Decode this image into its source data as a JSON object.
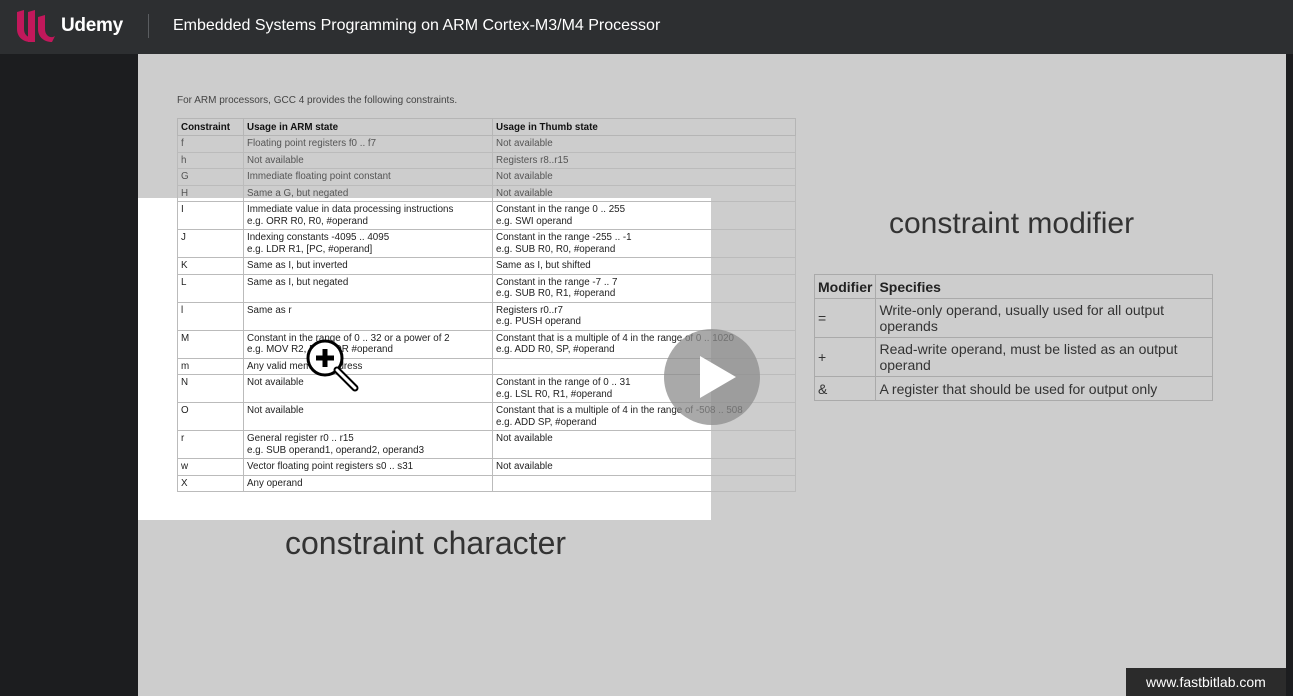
{
  "header": {
    "brand": "Udemy",
    "course_title": "Embedded Systems Programming on ARM Cortex-M3/M4 Processor"
  },
  "slide": {
    "intro": "For ARM processors, GCC 4 provides the following constraints.",
    "constraints_table": {
      "headers": [
        "Constraint",
        "Usage in ARM state",
        "Usage in Thumb state"
      ],
      "rows": [
        {
          "c": "f",
          "arm": "Floating point registers f0 .. f7",
          "thumb": "Not available"
        },
        {
          "c": "h",
          "arm": "Not available",
          "thumb": "Registers r8..r15"
        },
        {
          "c": "G",
          "arm": "Immediate floating point constant",
          "thumb": "Not available"
        },
        {
          "c": "H",
          "arm": "Same a G, but negated",
          "thumb": "Not available"
        },
        {
          "c": "I",
          "arm": "Immediate value in data processing instructions",
          "arm2": "e.g. ORR R0, R0, #operand",
          "thumb": "Constant in the range 0 .. 255",
          "thumb2": "e.g. SWI operand"
        },
        {
          "c": "J",
          "arm": "Indexing constants -4095 .. 4095",
          "arm2": "e.g. LDR R1, [PC, #operand]",
          "thumb": "Constant in the range -255 .. -1",
          "thumb2": "e.g. SUB R0, R0, #operand"
        },
        {
          "c": "K",
          "arm": "Same as I, but inverted",
          "thumb": "Same as I, but shifted"
        },
        {
          "c": "L",
          "arm": "Same as I, but negated",
          "thumb": "Constant in the range -7 .. 7",
          "thumb2": "e.g. SUB R0, R1, #operand"
        },
        {
          "c": "l",
          "arm": "Same as r",
          "thumb": "Registers r0..r7",
          "thumb2": "e.g. PUSH operand"
        },
        {
          "c": "M",
          "arm": "Constant in the range of 0 .. 32 or a power of 2",
          "arm2": "e.g. MOV R2, R1, ROR #operand",
          "thumb": "Constant that is a multiple of 4 in the range of 0 .. 1020",
          "thumb2": "e.g. ADD R0, SP, #operand"
        },
        {
          "c": "m",
          "arm": "Any valid memory address",
          "thumb": ""
        },
        {
          "c": "N",
          "arm": "Not available",
          "thumb": "Constant in the range of 0 .. 31",
          "thumb2": "e.g. LSL R0, R1, #operand"
        },
        {
          "c": "O",
          "arm": "Not available",
          "thumb": "Constant that is a multiple of 4 in the range of -508 .. 508",
          "thumb2": "e.g. ADD SP, #operand"
        },
        {
          "c": "r",
          "arm": "General register r0 .. r15",
          "arm2": "e.g. SUB operand1, operand2, operand3",
          "thumb": "Not available"
        },
        {
          "c": "w",
          "arm": "Vector floating point registers s0 .. s31",
          "thumb": "Not available"
        },
        {
          "c": "X",
          "arm": "Any operand",
          "thumb": ""
        }
      ]
    },
    "heading_modifier": "constraint modifier",
    "heading_character": "constraint character",
    "modifier_table": {
      "headers": [
        "Modifier",
        "Specifies"
      ],
      "rows": [
        {
          "m": "=",
          "s": "Write-only operand, usually used for all output operands"
        },
        {
          "m": "+",
          "s": "Read-write operand, must be listed as an output operand"
        },
        {
          "m": "&",
          "s": "A register that should be used for output only"
        }
      ]
    },
    "watermark": "www.fastbitlab.com"
  },
  "player": {
    "play_icon": "play-icon",
    "zoom_icon": "zoom-in-icon"
  },
  "colors": {
    "topbar": "#2d2f31",
    "slide_bg": "#cdcdcd",
    "brand_accent": "#a435f0"
  }
}
